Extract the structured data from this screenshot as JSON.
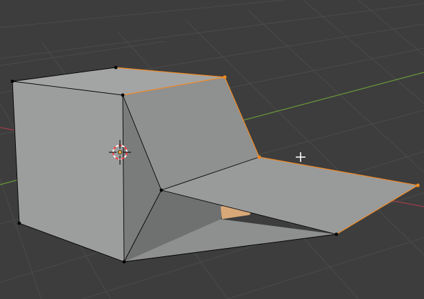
{
  "viewport": {
    "kind": "3d-viewport",
    "mode": "edit-mode",
    "background_color": "#3d3d3d",
    "grid_line_color": "#4b4b4b",
    "x_axis_color": "#a33c4a",
    "y_axis_color": "#6a9a3a"
  },
  "mesh": {
    "face_color": "#9b9c9c",
    "edge_color": "#000000",
    "selected_color": "#f08a24",
    "vertex_color": "#000000"
  },
  "gizmos": {
    "cursor": {
      "icon": "3d-cursor-icon",
      "ring_colors": [
        "#ff4040",
        "#ffffff"
      ]
    },
    "origin": {
      "icon": "object-origin-icon",
      "color": "#ffaa33"
    },
    "mouse": {
      "icon": "crosshair-cursor-icon",
      "color": "#ffffff"
    }
  }
}
